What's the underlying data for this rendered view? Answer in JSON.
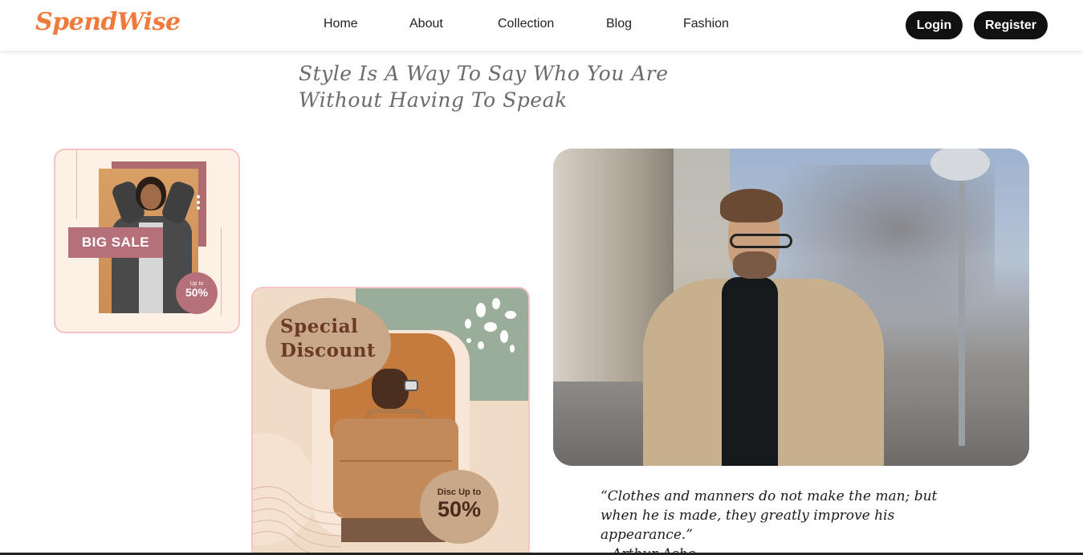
{
  "brand": {
    "logo": "SpendWise",
    "accent": "#f07a3a"
  },
  "nav": {
    "links": [
      "Home",
      "About",
      "Collection",
      "Blog",
      "Fashion"
    ],
    "login_label": "Login",
    "register_label": "Register"
  },
  "hero": {
    "quote": "Style Is A Way To Say Who You Are Without Having To Speak"
  },
  "promo_big_sale": {
    "banner": "BIG SALE",
    "badge_small": "Up to",
    "badge_large": "50%"
  },
  "promo_special": {
    "title": "Special Discount",
    "badge_small": "Disc Up to",
    "badge_large": "50%"
  },
  "quote": {
    "text": "“Clothes and manners do not make the man; but when he is made, they greatly improve his appearance.”",
    "author": "– Arthur Ashe"
  }
}
